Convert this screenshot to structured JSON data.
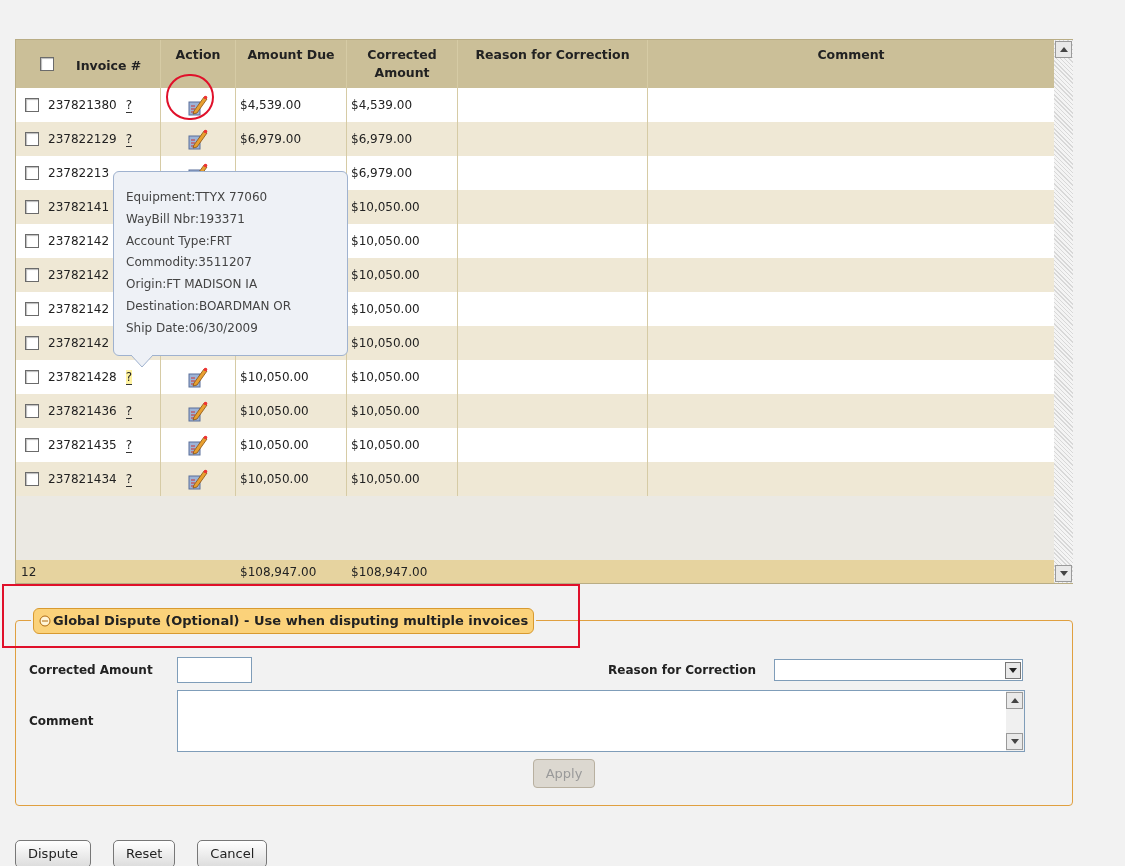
{
  "table": {
    "select_all": {
      "checked": false
    },
    "columns": [
      {
        "label": "Invoice #"
      },
      {
        "label": "Action"
      },
      {
        "label": "Amount Due"
      },
      {
        "label": "Corrected Amount"
      },
      {
        "label": "Reason for Correction"
      },
      {
        "label": "Comment"
      }
    ],
    "rows": [
      {
        "checked": false,
        "invoice": "237821380",
        "help": "?",
        "help_hovered": false,
        "action": true,
        "amount_due": "$4,539.00",
        "corrected_amount": "$4,539.00"
      },
      {
        "checked": false,
        "invoice": "237822129",
        "help": "?",
        "help_hovered": false,
        "action": true,
        "amount_due": "$6,979.00",
        "corrected_amount": "$6,979.00"
      },
      {
        "checked": false,
        "invoice": "23782213",
        "action": true,
        "corrected_amount": "$6,979.00"
      },
      {
        "checked": false,
        "invoice": "23782141",
        "corrected_amount": "$10,050.00"
      },
      {
        "checked": false,
        "invoice": "23782142",
        "corrected_amount": "$10,050.00"
      },
      {
        "checked": false,
        "invoice": "23782142",
        "corrected_amount": "$10,050.00"
      },
      {
        "checked": false,
        "invoice": "23782142",
        "corrected_amount": "$10,050.00"
      },
      {
        "checked": false,
        "invoice": "23782142",
        "corrected_amount": "$10,050.00"
      },
      {
        "checked": false,
        "invoice": "237821428",
        "help": "?",
        "help_hovered": true,
        "action": true,
        "amount_due": "$10,050.00",
        "corrected_amount": "$10,050.00"
      },
      {
        "checked": false,
        "invoice": "237821436",
        "help": "?",
        "help_hovered": false,
        "action": true,
        "amount_due": "$10,050.00",
        "corrected_amount": "$10,050.00"
      },
      {
        "checked": false,
        "invoice": "237821435",
        "help": "?",
        "help_hovered": false,
        "action": true,
        "amount_due": "$10,050.00",
        "corrected_amount": "$10,050.00"
      },
      {
        "checked": false,
        "invoice": "237821434",
        "help": "?",
        "help_hovered": false,
        "action": true,
        "amount_due": "$10,050.00",
        "corrected_amount": "$10,050.00"
      }
    ],
    "totals": {
      "count": "12",
      "amount_due": "$108,947.00",
      "corrected_amount": "$108,947.00"
    }
  },
  "tooltip": {
    "lines": [
      "Equipment:TTYX 77060",
      "WayBill Nbr:193371",
      "Account Type:FRT",
      "Commodity:3511207",
      "Origin:FT MADISON IA",
      "Destination:BOARDMAN OR",
      "Ship Date:06/30/2009"
    ]
  },
  "global_dispute": {
    "title": "Global Dispute (Optional) - Use when disputing multiple invoices",
    "expanded": true,
    "corrected_amount_label": "Corrected Amount",
    "reason_label": "Reason for Correction",
    "comment_label": "Comment",
    "apply": {
      "label": "Apply",
      "disabled": true
    }
  },
  "buttons": [
    {
      "label": "Dispute"
    },
    {
      "label": "Reset"
    },
    {
      "label": "Cancel"
    }
  ]
}
